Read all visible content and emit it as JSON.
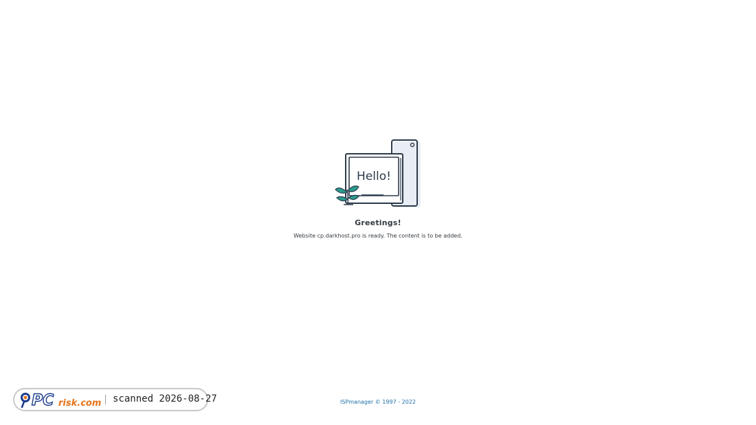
{
  "illustration": {
    "screen_text": "Hello!",
    "icon": "monitor-hello-icon",
    "colors": {
      "stroke": "#2b3a4a",
      "panel": "#e9eef5",
      "leaf": "#2a9d8f"
    }
  },
  "main": {
    "heading": "Greetings!",
    "message": "Website cp.darkhost.pro is ready. The content is to be added."
  },
  "footer": {
    "link": "ISPmanager",
    "copyright": "© 1997 - 2022",
    "color": "#1e6fa8"
  },
  "watermark": {
    "logo_text_pc": "PC",
    "logo_text_risk": "risk.com",
    "scan_text": "scanned 2026-08-27",
    "colors": {
      "pc": "#1a3c8c",
      "risk": "#e8731a"
    }
  }
}
